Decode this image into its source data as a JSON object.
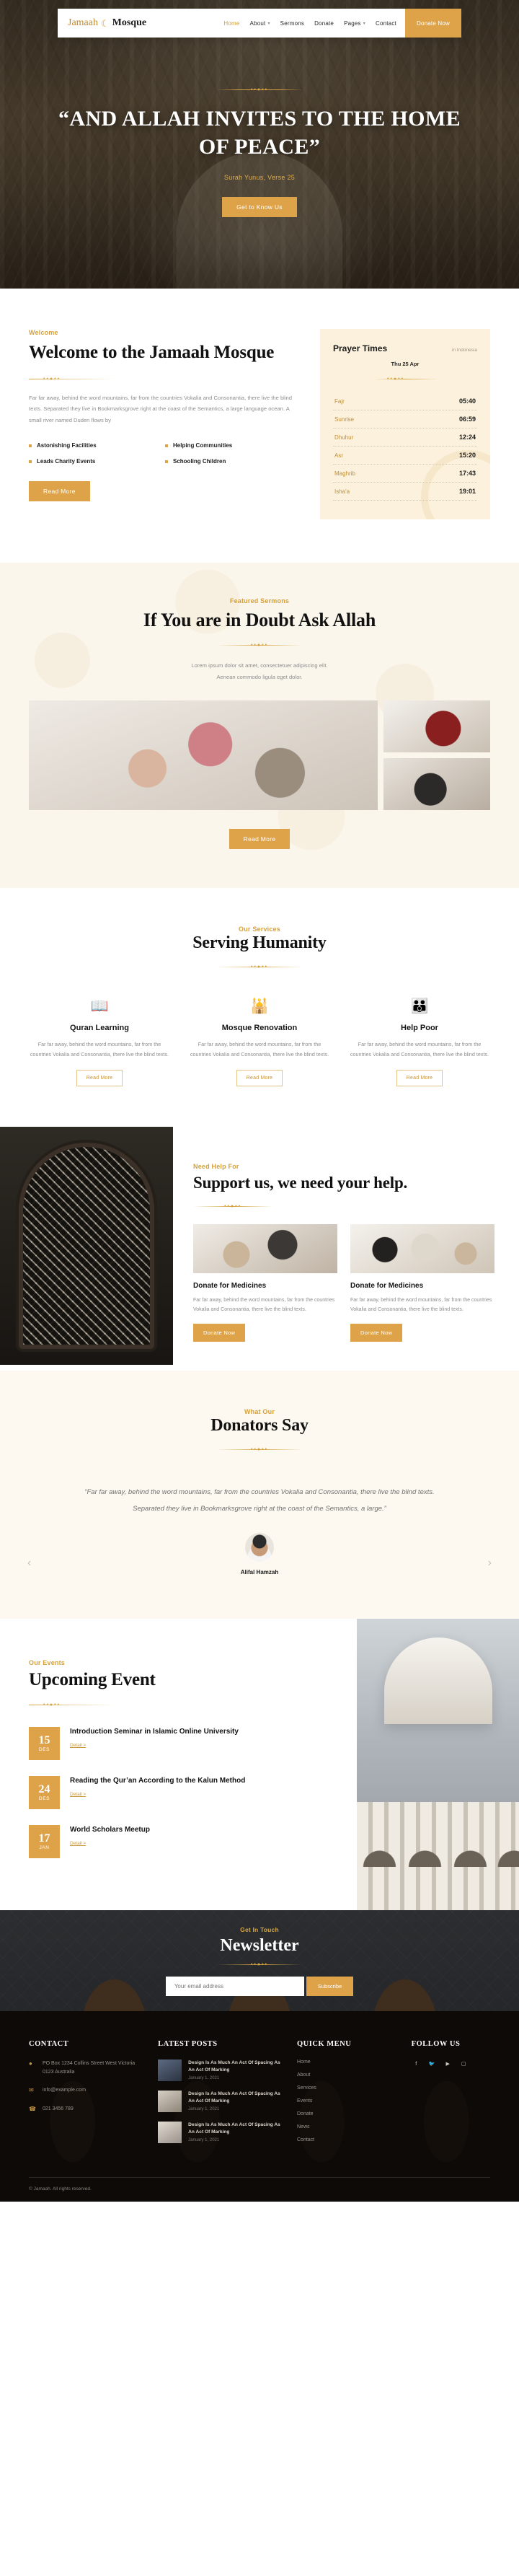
{
  "nav": {
    "brand_first": "Jamaah",
    "brand_icon": "crescent-moon-icon",
    "brand_second": "Mosque",
    "links": [
      {
        "label": "Home",
        "active": true,
        "caret": ""
      },
      {
        "label": "About",
        "active": false,
        "caret": "⌄"
      },
      {
        "label": "Sermons",
        "active": false,
        "caret": ""
      },
      {
        "label": "Donate",
        "active": false,
        "caret": ""
      },
      {
        "label": "Pages",
        "active": false,
        "caret": "⌄"
      },
      {
        "label": "Contact",
        "active": false,
        "caret": ""
      }
    ],
    "cta": "Donate Now"
  },
  "hero": {
    "title": "“AND ALLAH INVITES TO THE HOME OF PEACE”",
    "verse": "Surah Yunus, Verse 25",
    "cta": "Get to Know Us"
  },
  "welcome": {
    "eyebrow": "Welcome",
    "title": "Welcome to the Jamaah Mosque",
    "body": "Far far away, behind the word mountains, far from the countries Vokalia and Consonantia, there live the blind texts. Separated they live in Bookmarksgrove right at the coast of the Semantics, a large language ocean. A small river named Duden flows by",
    "features": [
      "Astonishing Facilities",
      "Helping Communities",
      "Leads Charity Events",
      "Schooling Children"
    ],
    "cta": "Read More"
  },
  "prayer": {
    "title": "Prayer Times",
    "location": "in Indonesia",
    "date": "Thu 25 Apr",
    "rows": [
      {
        "name": "Fajr",
        "time": "05:40"
      },
      {
        "name": "Sunrise",
        "time": "06:59"
      },
      {
        "name": "Dhuhur",
        "time": "12:24"
      },
      {
        "name": "Asr",
        "time": "15:20"
      },
      {
        "name": "Maghrib",
        "time": "17:43"
      },
      {
        "name": "Isha'a",
        "time": "19:01"
      }
    ]
  },
  "sermons": {
    "eyebrow": "Featured Sermons",
    "title": "If You are in Doubt Ask Allah",
    "body_l1": "Lorem ipsum dolor sit amet, consectetuer adipiscing elit.",
    "body_l2": "Aenean commodo ligula eget dolor.",
    "cta": "Read More"
  },
  "services": {
    "eyebrow": "Our Services",
    "title": "Serving Humanity",
    "cards": [
      {
        "icon": "quran-book-icon",
        "glyph": "▤",
        "title": "Quran Learning",
        "body": "Far far away, behind the word mountains, far from the countries Vokalia and Consonantia, there live the blind texts.",
        "cta": "Read More"
      },
      {
        "icon": "mosque-icon",
        "glyph": "☰",
        "title": "Mosque Renovation",
        "body": "Far far away, behind the word mountains, far from the countries Vokalia and Consonantia, there live the blind texts.",
        "cta": "Read More"
      },
      {
        "icon": "helping-hands-icon",
        "glyph": "☷",
        "title": "Help Poor",
        "body": "Far far away, behind the word mountains, far from the countries Vokalia and Consonantia, there live the blind texts.",
        "cta": "Read More"
      }
    ]
  },
  "donate": {
    "eyebrow": "Need Help For",
    "title": "Support us, we need your help.",
    "cards": [
      {
        "title": "Donate for Medicines",
        "body": "Far far away, behind the word mountains, far from the countries Vokalia and Consonantia, there live the blind texts.",
        "cta": "Donate Now"
      },
      {
        "title": "Donate for Medicines",
        "body": "Far far away, behind the word mountains, far from the countries Vokalia and Consonantia, there live the blind texts.",
        "cta": "Donate Now"
      }
    ]
  },
  "testimonial": {
    "eyebrow": "What Our",
    "title": "Donators Say",
    "quote": "“Far far away, behind the word mountains, far from the countries Vokalia and Consonantia, there live the blind texts. Separated they live in Bookmarksgrove right at the coast of the Semantics, a large.”",
    "author": "Alifal Hamzah",
    "prev": "‹",
    "next": "›"
  },
  "events": {
    "eyebrow": "Our Events",
    "title": "Upcoming Event",
    "items": [
      {
        "day": "15",
        "month": "DES",
        "title": "Introduction Seminar in Islamic Online University",
        "detail": "Detail >"
      },
      {
        "day": "24",
        "month": "DES",
        "title": "Reading the Qur’an According to the Kalun Method",
        "detail": "Detail >"
      },
      {
        "day": "17",
        "month": "JAN",
        "title": "World Scholars Meetup",
        "detail": "Detail >"
      }
    ]
  },
  "newsletter": {
    "eyebrow": "Get In Touch",
    "title": "Newsletter",
    "placeholder": "Your email address",
    "value": "",
    "cta": "Subscribe"
  },
  "footer": {
    "contact": {
      "heading": "CONTACT",
      "items": [
        {
          "icon": "location-pin-icon",
          "glyph": "◉",
          "text": "PO Box 1234 Collins Street West Victoria 0123 Australia"
        },
        {
          "icon": "envelope-icon",
          "glyph": "✉",
          "text": "info@example.com"
        },
        {
          "icon": "phone-icon",
          "glyph": "☎",
          "text": "021 3456 789"
        }
      ]
    },
    "posts": {
      "heading": "LATEST POSTS",
      "items": [
        {
          "title": "Design Is As Much An Act Of Spacing As An Act Of Marking",
          "date": "January 1, 2021"
        },
        {
          "title": "Design Is As Much An Act Of Spacing As An Act Of Marking",
          "date": "January 1, 2021"
        },
        {
          "title": "Design Is As Much An Act Of Spacing As An Act Of Marking",
          "date": "January 1, 2021"
        }
      ]
    },
    "menu": {
      "heading": "QUICK MENU",
      "items": [
        "Home",
        "About",
        "Services",
        "Events",
        "Donate",
        "News",
        "Contact"
      ]
    },
    "follow": {
      "heading": "FOLLOW US",
      "icons": [
        {
          "name": "facebook-icon",
          "glyph": "f"
        },
        {
          "name": "twitter-icon",
          "glyph": "ᵛ"
        },
        {
          "name": "youtube-icon",
          "glyph": "▶"
        },
        {
          "name": "instagram-icon",
          "glyph": "▣"
        }
      ]
    },
    "copyright": "© Jamaah. All rights reserved."
  },
  "colors": {
    "accent": "#dea348",
    "accent_text": "#d5a03a",
    "cream": "#fbf1dc",
    "dark": "#15110e"
  }
}
